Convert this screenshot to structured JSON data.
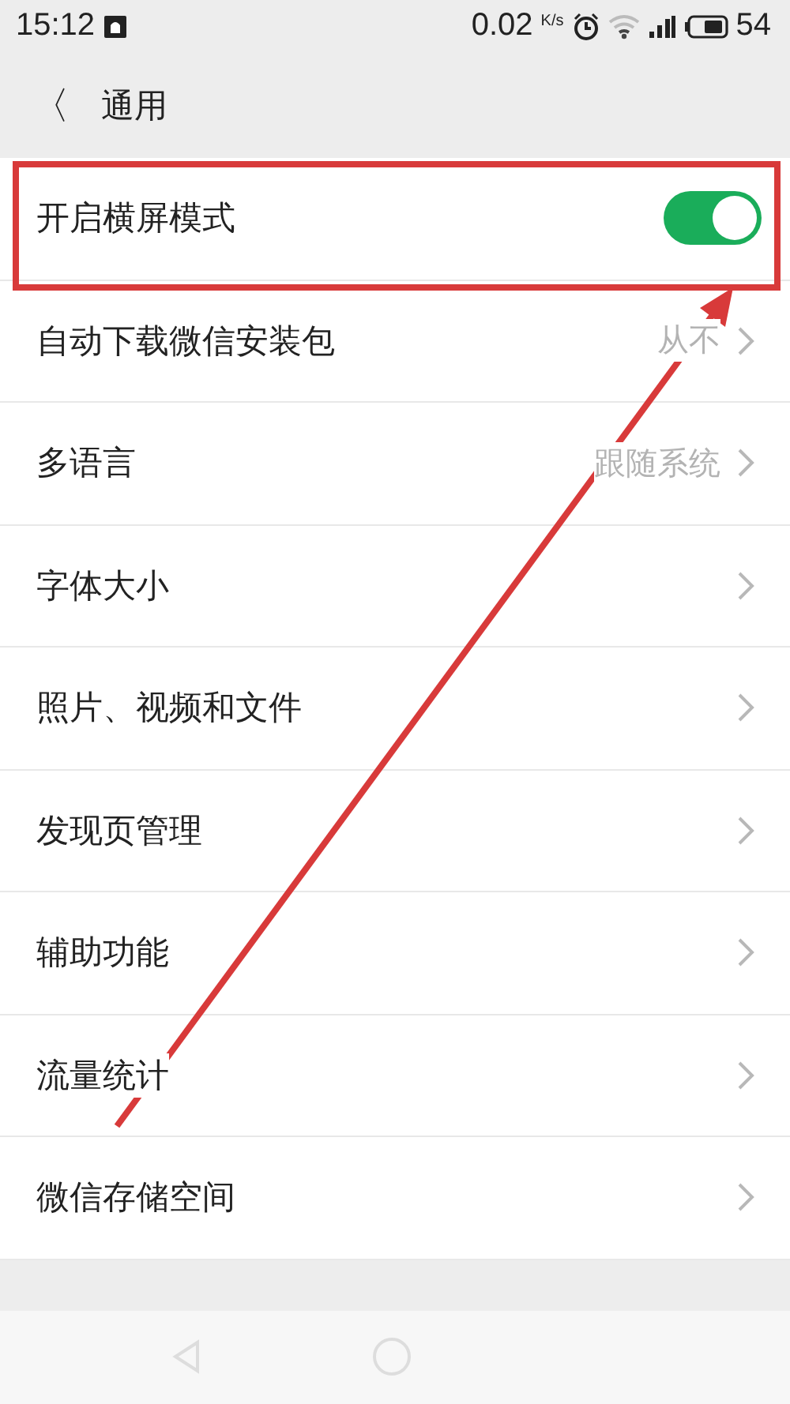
{
  "status_bar": {
    "time": "15:12",
    "speed": "0.02",
    "speed_unit": "K/s",
    "battery": "54"
  },
  "header": {
    "back": "〈",
    "title": "通用"
  },
  "settings": [
    {
      "kind": "toggle",
      "label": "开启横屏模式",
      "on": true
    },
    {
      "kind": "link",
      "label": "自动下载微信安装包",
      "value": "从不"
    },
    {
      "kind": "link",
      "label": "多语言",
      "value": "跟随系统"
    },
    {
      "kind": "link",
      "label": "字体大小"
    },
    {
      "kind": "link",
      "label": "照片、视频和文件"
    },
    {
      "kind": "link",
      "label": "发现页管理"
    },
    {
      "kind": "link",
      "label": "辅助功能"
    },
    {
      "kind": "link",
      "label": "流量统计"
    },
    {
      "kind": "link",
      "label": "微信存储空间"
    }
  ]
}
